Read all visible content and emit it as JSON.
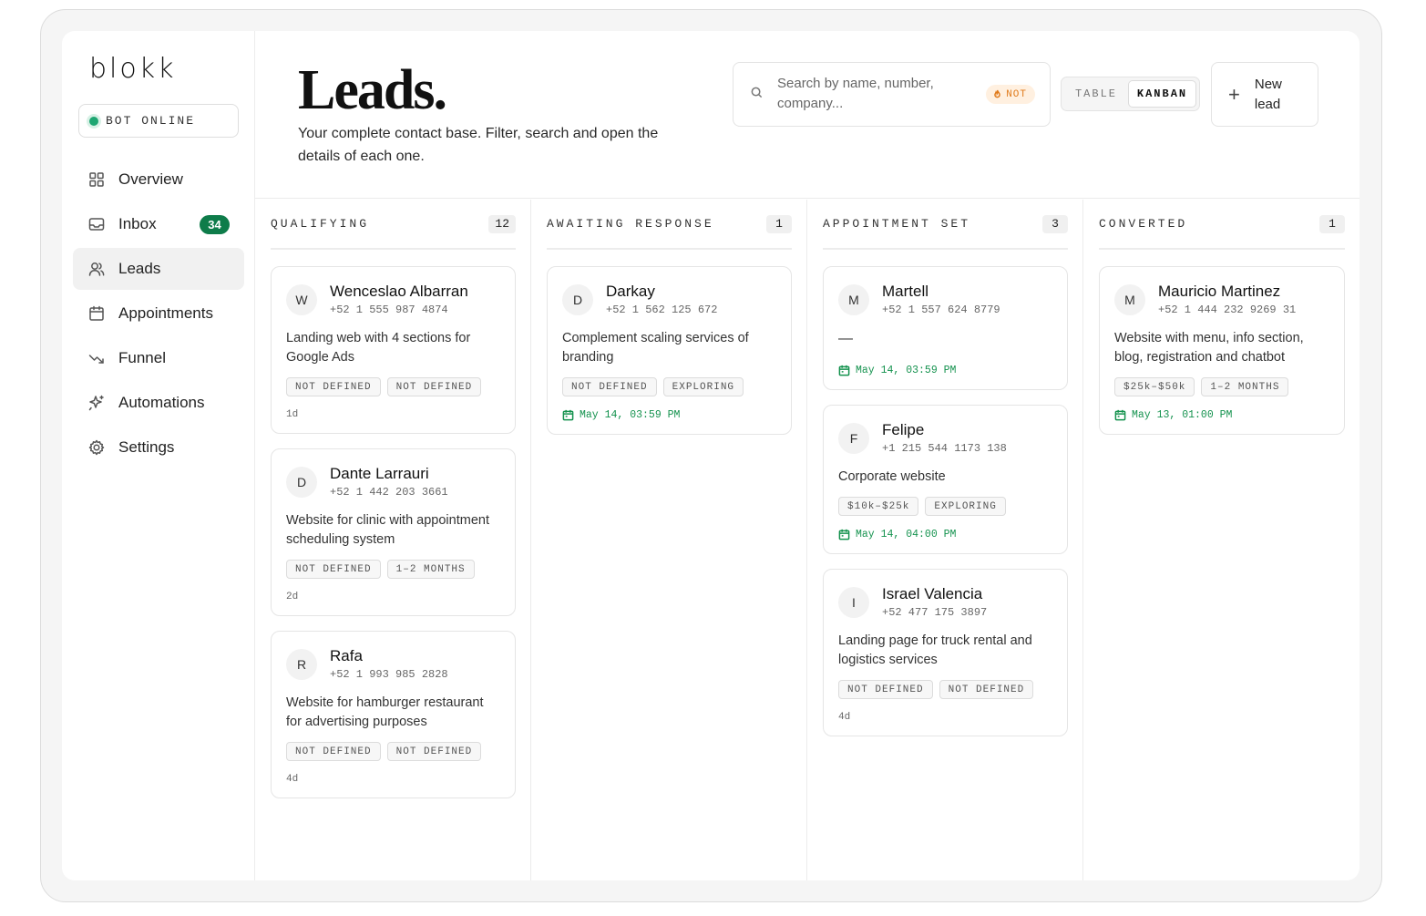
{
  "sidebar": {
    "brand": "blokk",
    "bot_status": "BOT ONLINE",
    "items": [
      {
        "label": "Overview",
        "icon": "grid-icon"
      },
      {
        "label": "Inbox",
        "icon": "inbox-icon",
        "badge": "34"
      },
      {
        "label": "Leads",
        "icon": "users-icon",
        "active": true
      },
      {
        "label": "Appointments",
        "icon": "calendar-icon"
      },
      {
        "label": "Funnel",
        "icon": "trend-down-icon"
      },
      {
        "label": "Automations",
        "icon": "sparkle-icon"
      },
      {
        "label": "Settings",
        "icon": "gear-icon"
      }
    ]
  },
  "header": {
    "title": "Leads.",
    "subtitle": "Your complete contact base. Filter, search and open the details of each one.",
    "search_placeholder": "Search by name, number, company...",
    "hot_filter": "NOT",
    "view_table": "TABLE",
    "view_kanban": "KANBAN",
    "new_lead": "New lead"
  },
  "colors": {
    "accent_green": "#0e7c4a",
    "appointment_green": "#14924e",
    "hot_orange": "#e07a1a"
  },
  "columns": [
    {
      "title": "QUALIFYING",
      "count": "12",
      "cards": [
        {
          "initial": "W",
          "name": "Wenceslao Albarran",
          "phone": "+52 1 555 987 4874",
          "desc": "Landing web with 4 sections for Google Ads",
          "tags": [
            "NOT DEFINED",
            "NOT DEFINED"
          ],
          "age": "1d"
        },
        {
          "initial": "D",
          "name": "Dante Larrauri",
          "phone": "+52 1 442 203 3661",
          "desc": "Website for clinic with appointment scheduling system",
          "tags": [
            "NOT DEFINED",
            "1–2 MONTHS"
          ],
          "age": "2d"
        },
        {
          "initial": "R",
          "name": "Rafa",
          "phone": "+52 1 993 985 2828",
          "desc": "Website for hamburger restaurant for advertising purposes",
          "tags": [
            "NOT DEFINED",
            "NOT DEFINED"
          ],
          "age": "4d"
        }
      ]
    },
    {
      "title": "AWAITING RESPONSE",
      "count": "1",
      "cards": [
        {
          "initial": "D",
          "name": "Darkay",
          "phone": "+52 1 562 125 672",
          "desc": "Complement scaling services of branding",
          "tags": [
            "NOT DEFINED",
            "EXPLORING"
          ],
          "appt": "May 14, 03:59 PM"
        }
      ]
    },
    {
      "title": "APPOINTMENT SET",
      "count": "3",
      "cards": [
        {
          "initial": "M",
          "name": "Martell",
          "phone": "+52 1 557 624 8779",
          "desc": "—",
          "tags": [],
          "appt": "May 14, 03:59 PM"
        },
        {
          "initial": "F",
          "name": "Felipe",
          "phone": "+1 215 544 1173 138",
          "desc": "Corporate website",
          "tags": [
            "$10k–$25k",
            "EXPLORING"
          ],
          "appt": "May 14, 04:00 PM"
        },
        {
          "initial": "I",
          "name": "Israel Valencia",
          "phone": "+52 477 175 3897",
          "desc": "Landing page for truck rental and logistics services",
          "tags": [
            "NOT DEFINED",
            "NOT DEFINED"
          ],
          "age": "4d"
        }
      ]
    },
    {
      "title": "CONVERTED",
      "count": "1",
      "cards": [
        {
          "initial": "M",
          "name": "Mauricio Martinez",
          "phone": "+52 1 444 232 9269 31",
          "desc": "Website with menu, info section, blog, registration and chatbot",
          "tags": [
            "$25k–$50k",
            "1–2 MONTHS"
          ],
          "appt": "May 13, 01:00 PM"
        }
      ]
    }
  ]
}
